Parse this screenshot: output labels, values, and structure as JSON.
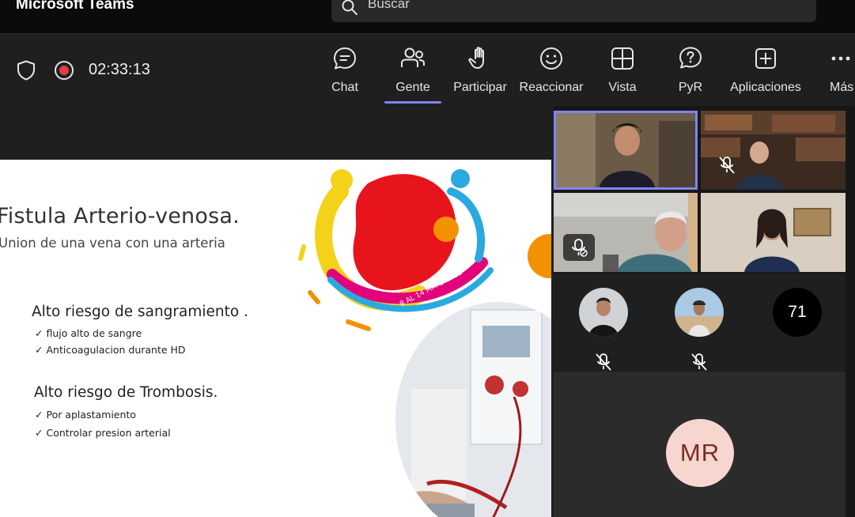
{
  "app": {
    "title": "Microsoft Teams"
  },
  "search": {
    "placeholder": "Buscar"
  },
  "meeting": {
    "timer": "02:33:13",
    "toolbar": [
      {
        "label": "Chat",
        "icon": "chat-icon"
      },
      {
        "label": "Gente",
        "icon": "people-icon",
        "active": true
      },
      {
        "label": "Participar",
        "icon": "raise-hand-icon"
      },
      {
        "label": "Reaccionar",
        "icon": "smiley-icon"
      },
      {
        "label": "Vista",
        "icon": "grid-view-icon"
      },
      {
        "label": "PyR",
        "icon": "qa-icon"
      },
      {
        "label": "Aplicaciones",
        "icon": "add-app-icon"
      },
      {
        "label": "Más",
        "icon": "more-icon"
      }
    ]
  },
  "slide": {
    "title": "Fistula Arterio-venosa.",
    "subtitle": "Union de una vena con una arteria",
    "sections": [
      {
        "heading": "Alto riesgo de sangramiento .",
        "bullets": [
          "flujo alto de sangre",
          "Anticoagulacion durante HD"
        ]
      },
      {
        "heading": "Alto riesgo de Trombosis.",
        "bullets": [
          "Por aplastamiento",
          "Controlar presion arterial"
        ]
      }
    ],
    "logo_text": "8 AL 14 MAYO 2023"
  },
  "participants": {
    "overflow_count": "71",
    "mr_initials": "MR"
  },
  "colors": {
    "accent": "#7f85f5",
    "record": "#e23d4a",
    "avatar_mr_bg": "#f7d6cf",
    "avatar_mr_fg": "#7b2d23"
  }
}
